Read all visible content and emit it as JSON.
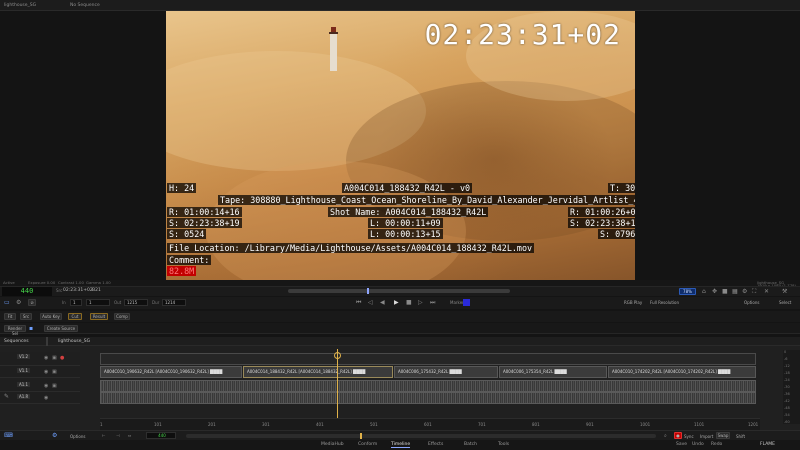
{
  "top_tabs": [
    "lighthouse_SG",
    "No Sequence"
  ],
  "viewer": {
    "timecode": "02:23:31+02",
    "burn_in": {
      "h": "H: 24",
      "clip_name": "A004C014_188432_R42L - v0",
      "t": "T: 30",
      "tape": "Tape: 308880_Lighthouse_Coast_Ocean_Shoreline_By_David_Alexander_Jervidal_Artlist_4K",
      "r_left": "R: 01:00:14+16",
      "shot_name": "Shot Name: A004C014_188432_R42L",
      "r_right": "R: 01:00:26+00",
      "s_left_tc": "S: 02:23:38+19",
      "l_in": "L: 00:00:11+09",
      "s_right_tc": "S: 02:23:38+19",
      "s_left": "S: 0524",
      "l_out": "L: 00:00:13+15",
      "s_right": "S: 0796",
      "file_location": "File Location: /Library/Media/Lighthouse/Assets/A004C014_188432_R42L.mov",
      "comment": "Comment:",
      "size": "82.8M"
    }
  },
  "info_row": [
    "Active",
    "Exposure 0.00",
    "Contrast 1.00",
    "Gamma 1.00",
    "lighthouse_SG",
    "1919 x 1080 (1.778)"
  ],
  "transport": {
    "timecode": "440",
    "src_tc_label": "Src",
    "src_tc": "02:23:31+02",
    "field_b": "B21",
    "in_label": "In",
    "in_value": "1",
    "out_label": "Out",
    "out_value": "1215",
    "dur_label": "Dur",
    "dur_value": "1214",
    "zoom": "78%",
    "marker_label": "Marker",
    "rgb_play": "RGB Play",
    "full_resolution": "Full Resolution",
    "options": "Options",
    "select": "Select"
  },
  "edit_tools": [
    "Fit",
    "Src",
    "Auto Key",
    "Cut",
    "Result",
    "Comp"
  ],
  "render_buttons": [
    "Render Sel",
    "Create Source"
  ],
  "sequence_tabs": [
    "Sequences",
    "lighthouse_SG"
  ],
  "tracks": [
    {
      "name": "V1.2",
      "type": "video"
    },
    {
      "name": "V1.1",
      "type": "video"
    },
    {
      "name": "A1.1",
      "type": "audio"
    },
    {
      "name": "A1.R",
      "type": "audio"
    }
  ],
  "video_clips": [
    "A004C010_190632_R42L [A004C010_190632_R42L] ████",
    "A004C014_188432_R42L [A004C014_188432_R42L] ████",
    "A004C006_175432_R42L ████",
    "A004C006_175354_R42L ████",
    "A004C010_174202_R42L [A004C010_174202_R42L] ████"
  ],
  "ruler_ticks": [
    "1",
    "101",
    "201",
    "301",
    "401",
    "501",
    "601",
    "701",
    "801",
    "901",
    "1001",
    "1101",
    "1201"
  ],
  "scale_ticks": [
    "0",
    "-6",
    "-12",
    "-18",
    "-24",
    "-30",
    "-36",
    "-42",
    "-48",
    "-54",
    "-60"
  ],
  "bottom": {
    "options": "Options",
    "frame_readout": "440",
    "sync": "Sync",
    "import": "Import",
    "swap": "Swap",
    "shift": "Shift",
    "save": "Save",
    "undo": "Undo",
    "redo": "Redo",
    "brand": "FLAME"
  },
  "footer_tabs": [
    "MediaHub",
    "Conform",
    "Timeline",
    "Effects",
    "Batch",
    "Tools"
  ],
  "colors": {
    "accent_green": "#46d34a",
    "accent_blue": "#2b5ab8",
    "record_red": "#c20000",
    "playhead": "#e0b24a"
  }
}
